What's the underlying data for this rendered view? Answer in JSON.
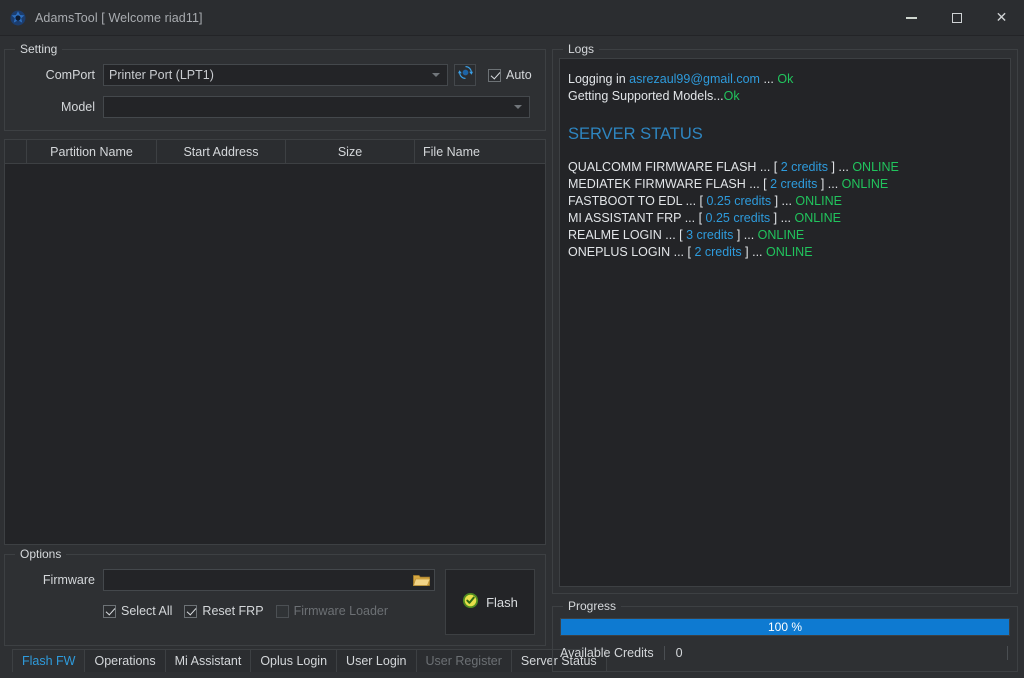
{
  "window": {
    "title": "AdamsTool [ Welcome riad11]",
    "app_icon": "app-logo-icon",
    "controls": {
      "minimize": "minimize-icon",
      "maximize": "maximize-icon",
      "close": "close-icon"
    }
  },
  "setting": {
    "group_title": "Setting",
    "comport": {
      "label": "ComPort",
      "value": "Printer Port (LPT1)",
      "placeholder": "",
      "refresh_icon": "refresh-icon"
    },
    "auto": {
      "label": "Auto",
      "checked": true
    },
    "model": {
      "label": "Model",
      "value": "",
      "placeholder": ""
    }
  },
  "partition_table": {
    "columns": [
      "Partition Name",
      "Start Address",
      "Size",
      "File Name"
    ],
    "rows": []
  },
  "options": {
    "group_title": "Options",
    "firmware": {
      "label": "Firmware",
      "value": "",
      "placeholder": "",
      "browse_icon": "folder-open-icon"
    },
    "checkboxes": [
      {
        "label": "Select All",
        "checked": true,
        "enabled": true
      },
      {
        "label": "Reset FRP",
        "checked": true,
        "enabled": true
      },
      {
        "label": "Firmware Loader",
        "checked": false,
        "enabled": false
      }
    ],
    "flash_button": {
      "label": "Flash",
      "icon": "shield-check-icon"
    }
  },
  "tabs": [
    {
      "label": "Flash FW",
      "active": true,
      "enabled": true
    },
    {
      "label": "Operations",
      "active": false,
      "enabled": true
    },
    {
      "label": "Mi Assistant",
      "active": false,
      "enabled": true
    },
    {
      "label": "Oplus Login",
      "active": false,
      "enabled": true
    },
    {
      "label": "User Login",
      "active": false,
      "enabled": true
    },
    {
      "label": "User Register",
      "active": false,
      "enabled": false
    },
    {
      "label": "Server Status",
      "active": false,
      "enabled": true
    }
  ],
  "logs": {
    "group_title": "Logs",
    "line1": {
      "prefix": "Logging in ",
      "email": "asrezaul99@gmail.com",
      "dots": " ... ",
      "status": "Ok"
    },
    "line2": {
      "prefix": "Getting Supported Models...",
      "status": "Ok"
    },
    "heading": "SERVER STATUS",
    "services": [
      {
        "name": "QUALCOMM FIRMWARE FLASH",
        "sep1": " ... [ ",
        "credits": "2 credits",
        "sep2": "  ] ... ",
        "status": "ONLINE"
      },
      {
        "name": "MEDIATEK FIRMWARE FLASH",
        "sep1": " ... [ ",
        "credits": "2 credits",
        "sep2": "  ] ... ",
        "status": "ONLINE"
      },
      {
        "name": "FASTBOOT TO EDL",
        "sep1": " ... [ ",
        "credits": "0.25 credits",
        "sep2": "  ] ... ",
        "status": "ONLINE"
      },
      {
        "name": "MI ASSISTANT FRP",
        "sep1": " ... [ ",
        "credits": "0.25 credits",
        "sep2": "  ] ... ",
        "status": "ONLINE"
      },
      {
        "name": "REALME LOGIN",
        "sep1": " ... [ ",
        "credits": "3 credits",
        "sep2": "  ] ... ",
        "status": "ONLINE"
      },
      {
        "name": "ONEPLUS LOGIN",
        "sep1": " ... [ ",
        "credits": "2 credits",
        "sep2": " ] ... ",
        "status": "ONLINE"
      }
    ]
  },
  "progress": {
    "group_title": "Progress",
    "percent_label": "100 %",
    "percent_value": 100,
    "credits_label": "Available Credits",
    "credits_value": "0"
  },
  "colors": {
    "accent_blue": "#2e9bdc",
    "heading_blue": "#2e86c1",
    "ok_green": "#21c45d",
    "progress_blue": "#0e7ad1",
    "window_bg": "#2e3033",
    "field_bg": "#232427"
  }
}
